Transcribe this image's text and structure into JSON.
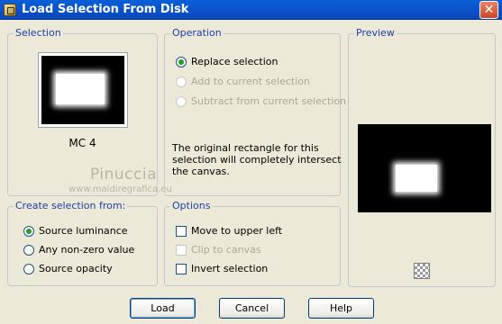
{
  "window": {
    "title": "Load Selection From Disk",
    "close_glyph": "✕"
  },
  "selection": {
    "legend": "Selection",
    "thumbnail_label": "MC 4"
  },
  "watermark": {
    "name": "Pinuccia",
    "url": "www.maidiregrafica.eu"
  },
  "operation": {
    "legend": "Operation",
    "options": [
      {
        "label": "Replace selection",
        "checked": true,
        "enabled": true
      },
      {
        "label": "Add to current selection",
        "checked": false,
        "enabled": false
      },
      {
        "label": "Subtract from current selection",
        "checked": false,
        "enabled": false
      }
    ],
    "info": "The original rectangle for this selection will completely intersect the canvas."
  },
  "preview": {
    "legend": "Preview",
    "icon": "checkerboard-icon"
  },
  "create_from": {
    "legend": "Create selection from:",
    "options": [
      {
        "label": "Source luminance",
        "checked": true
      },
      {
        "label": "Any non-zero value",
        "checked": false
      },
      {
        "label": "Source opacity",
        "checked": false
      }
    ]
  },
  "options": {
    "legend": "Options",
    "items": [
      {
        "label": "Move to upper left",
        "checked": false,
        "enabled": true
      },
      {
        "label": "Clip to canvas",
        "checked": false,
        "enabled": false
      },
      {
        "label": "Invert selection",
        "checked": false,
        "enabled": true
      }
    ]
  },
  "buttons": {
    "load": "Load",
    "cancel": "Cancel",
    "help": "Help"
  },
  "colors": {
    "titlebar": "#0A54CC",
    "dialog_bg": "#ECE9D8",
    "legend_text": "#1E3EA6",
    "radio_dot": "#21A121"
  }
}
